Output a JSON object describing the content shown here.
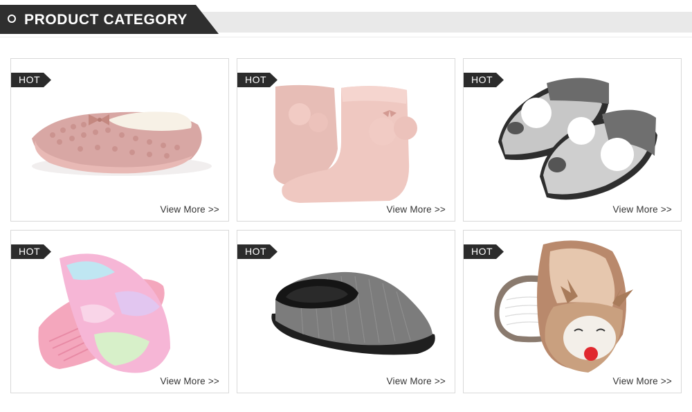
{
  "header": {
    "title": "PRODUCT CATEGORY"
  },
  "products": [
    {
      "badge": "HOT",
      "link": "View More >>",
      "image": "pink-knit-slipper-image"
    },
    {
      "badge": "HOT",
      "link": "View More >>",
      "image": "pink-fur-boot-image"
    },
    {
      "badge": "HOT",
      "link": "View More >>",
      "image": "grey-koala-slipper-image"
    },
    {
      "badge": "HOT",
      "link": "View More >>",
      "image": "rainbow-fur-slide-image"
    },
    {
      "badge": "HOT",
      "link": "View More >>",
      "image": "grey-clog-slipper-image"
    },
    {
      "badge": "HOT",
      "link": "View More >>",
      "image": "reindeer-slipper-image"
    }
  ],
  "colors": {
    "header_dark": "#2f2f2f",
    "header_bar": "#e9e9e9",
    "badge": "#2b2b2b",
    "card_border": "#d8d8d8"
  }
}
